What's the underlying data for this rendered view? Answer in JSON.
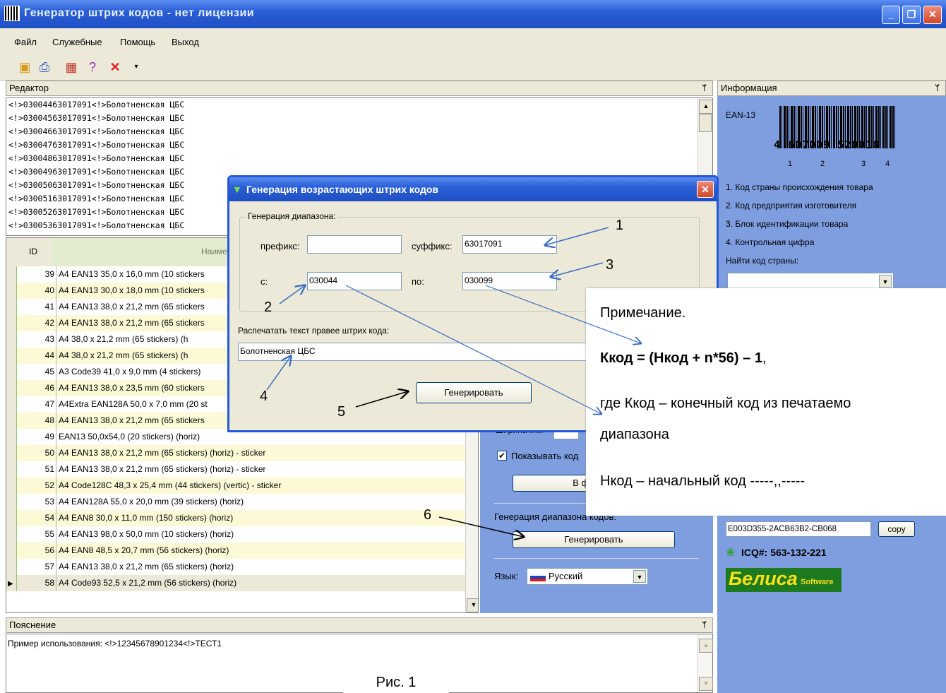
{
  "window": {
    "title": "Генератор штрих кодов - нет лицензии"
  },
  "menu": [
    "Файл",
    "Служебные",
    "Помощь",
    "Выход"
  ],
  "panels": {
    "editor": "Редактор",
    "info": "Информация",
    "explanation": "Пояснение"
  },
  "editor_lines": [
    "<!>03004463017091<!>Болотненская ЦБС",
    "<!>03004563017091<!>Болотненская ЦБС",
    "<!>03004663017091<!>Болотненская ЦБС",
    "<!>03004763017091<!>Болотненская ЦБС",
    "<!>03004863017091<!>Болотненская ЦБС",
    "<!>03004963017091<!>Болотненская ЦБС",
    "<!>03005063017091<!>Болотненская ЦБС",
    "<!>03005163017091<!>Болотненская ЦБС",
    "<!>03005263017091<!>Болотненская ЦБС",
    "<!>03005363017091<!>Болотненская ЦБС"
  ],
  "table": {
    "headers": {
      "id": "ID",
      "name": "Наиме"
    },
    "rows": [
      {
        "id": "39",
        "name": "A4 EAN13  35,0 x 16,0 mm  (10 stickers"
      },
      {
        "id": "40",
        "name": "A4 EAN13  30,0 x 18,0 mm  (10 stickers"
      },
      {
        "id": "41",
        "name": "A4 EAN13  38,0 x 21,2 mm  (65 stickers"
      },
      {
        "id": "42",
        "name": "A4 EAN13  38,0 x 21,2 mm  (65 stickers"
      },
      {
        "id": "43",
        "name": "A4        38,0 x 21,2 mm  (65 stickers) (h"
      },
      {
        "id": "44",
        "name": "A4        38,0 x 21,2 mm  (65 stickers) (h"
      },
      {
        "id": "45",
        "name": "A3 Code39  41,0 x 9,0 mm  (4 stickers)"
      },
      {
        "id": "46",
        "name": "A4 EAN13  38,0 x 23,5 mm  (60 stickers"
      },
      {
        "id": "47",
        "name": "A4Extra EAN128A 50,0 x 7,0 mm (20 st"
      },
      {
        "id": "48",
        "name": "A4 EAN13  38,0 x 21,2 mm  (65 stickers"
      },
      {
        "id": "49",
        "name": "EAN13 50,0x54,0 (20 stickers) (horiz)"
      },
      {
        "id": "50",
        "name": "A4 EAN13  38,0 x 21,2 mm  (65 stickers) (horiz)  - sticker"
      },
      {
        "id": "51",
        "name": "A4 EAN13  38,0 x 21,2 mm  (65 stickers) (horiz)  - sticker"
      },
      {
        "id": "52",
        "name": "A4 Code128C  48,3 x 25,4 mm (44 stickers) (vertic)  - sticker"
      },
      {
        "id": "53",
        "name": "A4 EAN128A 55,0 x 20,0 mm (39 stickers) (horiz)"
      },
      {
        "id": "54",
        "name": "A4 EAN8 30,0 x 11,0 mm  (150 stickers) (horiz)"
      },
      {
        "id": "55",
        "name": "A4 EAN13 98,0 x 50,0 mm  (10 stickers) (horiz)"
      },
      {
        "id": "56",
        "name": "A4 EAN8 48,5 x 20,7 mm  (56 stickers) (horiz)"
      },
      {
        "id": "57",
        "name": "A4 EAN13 38,0 x 21,2 mm  (65 stickers) (horiz)"
      },
      {
        "id": "58",
        "name": "A4 Code93 52,5 x 21,2 mm  (56 stickers) (horiz)"
      }
    ]
  },
  "middle": {
    "width_label": "Ширина мм:",
    "show_code_label": "Показывать код",
    "to_file_button": "В файл М",
    "range_gen_label": "Генерация диапазона кодов:",
    "generate_button": "Генерировать",
    "lang_label": "Язык:",
    "lang_value": "Русский"
  },
  "info": {
    "ean_label": "EAN-13",
    "barcode_digits": "4 607009 520018",
    "barcode_groups": [
      "1",
      "2",
      "3",
      "4"
    ],
    "items": [
      "1. Код страны происхождения товара",
      "2. Код предприятия изготовителя",
      "3. Блок идентификации товара",
      "4. Контрольная цифра"
    ],
    "find_country_label": "Найти код страны:",
    "license_code": "E003D355-2ACB63B2-CB068",
    "copy_button": "copy",
    "icq": "ICQ#: 563-132-221",
    "brand": "Белиса",
    "brand_sub": "Software"
  },
  "explanation_text": "Пример использования: <!>12345678901234<!>ТЕСТ1",
  "dialog": {
    "title": "Генерация возрастающих штрих кодов",
    "group_label": "Генерация диапазона:",
    "prefix_label": "префикс:",
    "prefix_value": "",
    "suffix_label": "суффикс:",
    "suffix_value": "63017091",
    "from_label": "с:",
    "from_value": "030044",
    "to_label": "по:",
    "to_value": "030099",
    "print_text_label": "Распечатать текст правее штрих кода:",
    "print_text_value": "Болотненская ЦБС",
    "generate_button": "Генерировать"
  },
  "note": {
    "heading": "Примечание.",
    "formula": "Ккод = (Нкод + n*56) – 1",
    "formula_tail": ",",
    "line1": "где Ккод – конечный код из печатаемо",
    "line2": "диапазона",
    "line3": "Нкод – начальный код -----,,-----"
  },
  "callouts": [
    "1",
    "2",
    "3",
    "4",
    "5",
    "6"
  ],
  "caption": "Рис. 1"
}
